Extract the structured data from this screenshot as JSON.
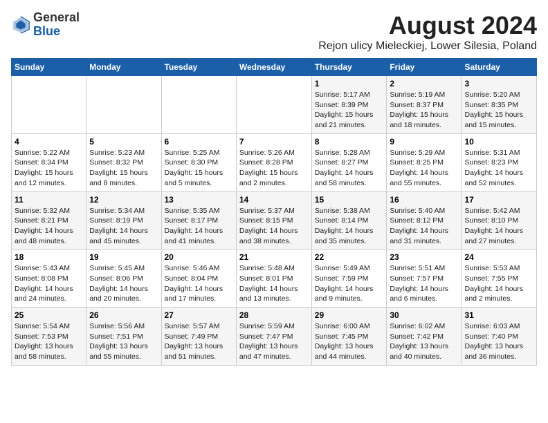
{
  "logo": {
    "general": "General",
    "blue": "Blue"
  },
  "title": "August 2024",
  "subtitle": "Rejon ulicy Mieleckiej, Lower Silesia, Poland",
  "days_of_week": [
    "Sunday",
    "Monday",
    "Tuesday",
    "Wednesday",
    "Thursday",
    "Friday",
    "Saturday"
  ],
  "weeks": [
    [
      {
        "day": "",
        "info": ""
      },
      {
        "day": "",
        "info": ""
      },
      {
        "day": "",
        "info": ""
      },
      {
        "day": "",
        "info": ""
      },
      {
        "day": "1",
        "info": "Sunrise: 5:17 AM\nSunset: 8:39 PM\nDaylight: 15 hours\nand 21 minutes."
      },
      {
        "day": "2",
        "info": "Sunrise: 5:19 AM\nSunset: 8:37 PM\nDaylight: 15 hours\nand 18 minutes."
      },
      {
        "day": "3",
        "info": "Sunrise: 5:20 AM\nSunset: 8:35 PM\nDaylight: 15 hours\nand 15 minutes."
      }
    ],
    [
      {
        "day": "4",
        "info": "Sunrise: 5:22 AM\nSunset: 8:34 PM\nDaylight: 15 hours\nand 12 minutes."
      },
      {
        "day": "5",
        "info": "Sunrise: 5:23 AM\nSunset: 8:32 PM\nDaylight: 15 hours\nand 8 minutes."
      },
      {
        "day": "6",
        "info": "Sunrise: 5:25 AM\nSunset: 8:30 PM\nDaylight: 15 hours\nand 5 minutes."
      },
      {
        "day": "7",
        "info": "Sunrise: 5:26 AM\nSunset: 8:28 PM\nDaylight: 15 hours\nand 2 minutes."
      },
      {
        "day": "8",
        "info": "Sunrise: 5:28 AM\nSunset: 8:27 PM\nDaylight: 14 hours\nand 58 minutes."
      },
      {
        "day": "9",
        "info": "Sunrise: 5:29 AM\nSunset: 8:25 PM\nDaylight: 14 hours\nand 55 minutes."
      },
      {
        "day": "10",
        "info": "Sunrise: 5:31 AM\nSunset: 8:23 PM\nDaylight: 14 hours\nand 52 minutes."
      }
    ],
    [
      {
        "day": "11",
        "info": "Sunrise: 5:32 AM\nSunset: 8:21 PM\nDaylight: 14 hours\nand 48 minutes."
      },
      {
        "day": "12",
        "info": "Sunrise: 5:34 AM\nSunset: 8:19 PM\nDaylight: 14 hours\nand 45 minutes."
      },
      {
        "day": "13",
        "info": "Sunrise: 5:35 AM\nSunset: 8:17 PM\nDaylight: 14 hours\nand 41 minutes."
      },
      {
        "day": "14",
        "info": "Sunrise: 5:37 AM\nSunset: 8:15 PM\nDaylight: 14 hours\nand 38 minutes."
      },
      {
        "day": "15",
        "info": "Sunrise: 5:38 AM\nSunset: 8:14 PM\nDaylight: 14 hours\nand 35 minutes."
      },
      {
        "day": "16",
        "info": "Sunrise: 5:40 AM\nSunset: 8:12 PM\nDaylight: 14 hours\nand 31 minutes."
      },
      {
        "day": "17",
        "info": "Sunrise: 5:42 AM\nSunset: 8:10 PM\nDaylight: 14 hours\nand 27 minutes."
      }
    ],
    [
      {
        "day": "18",
        "info": "Sunrise: 5:43 AM\nSunset: 8:08 PM\nDaylight: 14 hours\nand 24 minutes."
      },
      {
        "day": "19",
        "info": "Sunrise: 5:45 AM\nSunset: 8:06 PM\nDaylight: 14 hours\nand 20 minutes."
      },
      {
        "day": "20",
        "info": "Sunrise: 5:46 AM\nSunset: 8:04 PM\nDaylight: 14 hours\nand 17 minutes."
      },
      {
        "day": "21",
        "info": "Sunrise: 5:48 AM\nSunset: 8:01 PM\nDaylight: 14 hours\nand 13 minutes."
      },
      {
        "day": "22",
        "info": "Sunrise: 5:49 AM\nSunset: 7:59 PM\nDaylight: 14 hours\nand 9 minutes."
      },
      {
        "day": "23",
        "info": "Sunrise: 5:51 AM\nSunset: 7:57 PM\nDaylight: 14 hours\nand 6 minutes."
      },
      {
        "day": "24",
        "info": "Sunrise: 5:53 AM\nSunset: 7:55 PM\nDaylight: 14 hours\nand 2 minutes."
      }
    ],
    [
      {
        "day": "25",
        "info": "Sunrise: 5:54 AM\nSunset: 7:53 PM\nDaylight: 13 hours\nand 58 minutes."
      },
      {
        "day": "26",
        "info": "Sunrise: 5:56 AM\nSunset: 7:51 PM\nDaylight: 13 hours\nand 55 minutes."
      },
      {
        "day": "27",
        "info": "Sunrise: 5:57 AM\nSunset: 7:49 PM\nDaylight: 13 hours\nand 51 minutes."
      },
      {
        "day": "28",
        "info": "Sunrise: 5:59 AM\nSunset: 7:47 PM\nDaylight: 13 hours\nand 47 minutes."
      },
      {
        "day": "29",
        "info": "Sunrise: 6:00 AM\nSunset: 7:45 PM\nDaylight: 13 hours\nand 44 minutes."
      },
      {
        "day": "30",
        "info": "Sunrise: 6:02 AM\nSunset: 7:42 PM\nDaylight: 13 hours\nand 40 minutes."
      },
      {
        "day": "31",
        "info": "Sunrise: 6:03 AM\nSunset: 7:40 PM\nDaylight: 13 hours\nand 36 minutes."
      }
    ]
  ]
}
